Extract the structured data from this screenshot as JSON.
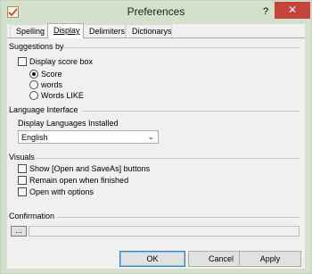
{
  "window": {
    "title": "Preferences",
    "help_label": "?",
    "close_label": "✕"
  },
  "tabs": [
    {
      "label": "Spelling",
      "active": false
    },
    {
      "label": "Display",
      "active": true
    },
    {
      "label": "Delimiters",
      "active": false
    },
    {
      "label": "Dictionarys",
      "active": false
    }
  ],
  "suggestions": {
    "heading": "Suggestions by",
    "display_score_box": {
      "label": "Display score box",
      "checked": false
    },
    "options": [
      {
        "label": "Score",
        "selected": true
      },
      {
        "label": "words",
        "selected": false
      },
      {
        "label": "Words LIKE",
        "selected": false
      }
    ]
  },
  "language": {
    "heading": "Language Interface",
    "installed_label": "Display Languages Installed",
    "selected": "English"
  },
  "visuals": {
    "heading": "Visuals",
    "options": [
      {
        "label": "Show [Open and SaveAs] buttons",
        "checked": false
      },
      {
        "label": "Remain open when finished",
        "checked": false
      },
      {
        "label": "Open with options",
        "checked": false
      }
    ]
  },
  "confirmation": {
    "heading": "Confirmation",
    "browse_label": "...",
    "path_value": ""
  },
  "footer": {
    "ok_label": "OK",
    "cancel_label": "Cancel",
    "apply_label": "Apply"
  }
}
